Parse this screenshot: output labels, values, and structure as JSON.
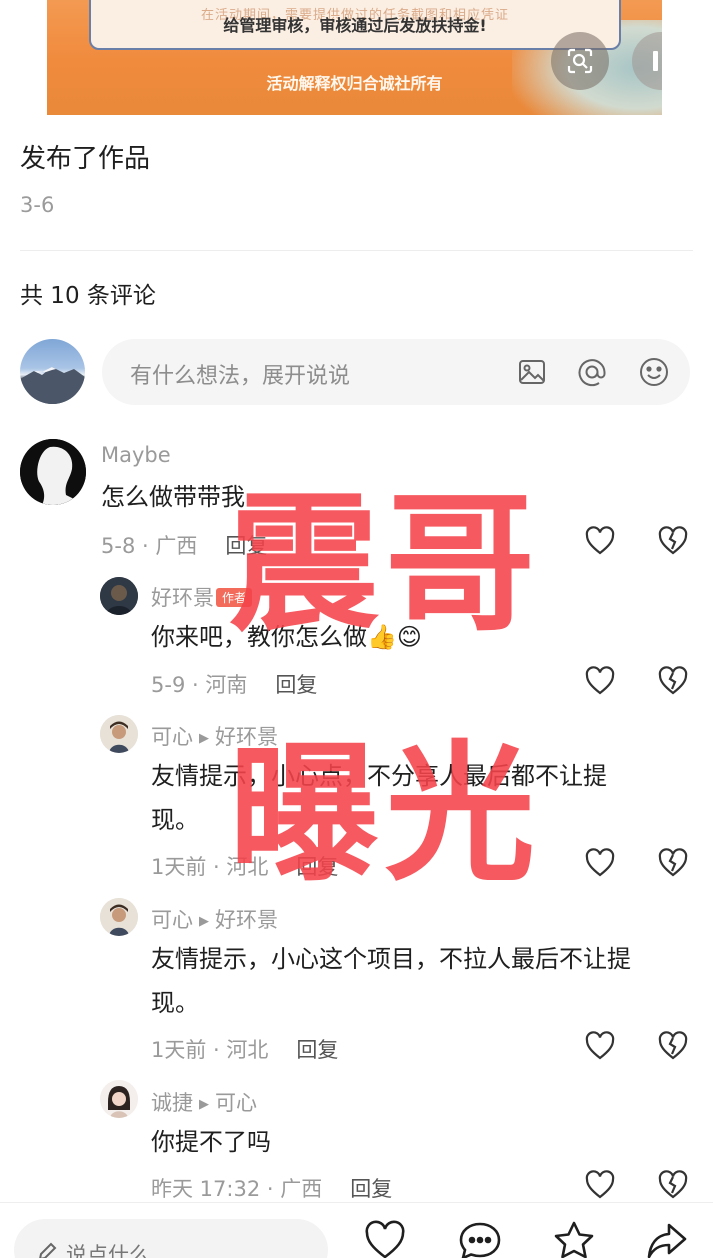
{
  "banner": {
    "notice_line1": "在活动期间，需要提供做过的任务截图和相应凭证",
    "notice_line2": "给管理审核，审核通过后发放扶持金!",
    "footer": "活动解释权归合诚社所有",
    "icons": {
      "lens": "lens-search-icon",
      "pause": "pause-icon"
    }
  },
  "post": {
    "title": "发布了作品",
    "date": "3-6"
  },
  "comments_header": "共 10 条评论",
  "comment_input": {
    "placeholder": "有什么想法，展开说说",
    "icons": [
      "image-icon",
      "at-icon",
      "emoji-icon"
    ]
  },
  "comments": [
    {
      "user": "Maybe",
      "text": "怎么做带带我",
      "meta": "5-8 · 广西",
      "reply": "回复"
    },
    {
      "user": "好环景",
      "badge": "作者",
      "text": "你来吧，教你怎么做👍😊",
      "meta": "5-9 · 河南",
      "reply": "回复"
    },
    {
      "user": "可心",
      "reply_to": "好环景",
      "text_line1": "友情提示，小心点，不分享人最后都不让提",
      "text_line2": "现。",
      "meta": "1天前 · 河北",
      "reply": "回复"
    },
    {
      "user": "可心",
      "reply_to": "好环景",
      "text_line1": "友情提示，小心这个项目，不拉人最后不让提",
      "text_line2": "现。",
      "meta": "1天前 · 河北",
      "reply": "回复"
    },
    {
      "user": "诚捷",
      "reply_to": "可心",
      "text": "你提不了吗",
      "meta": "昨天 17:32 · 广西",
      "reply": "回复"
    }
  ],
  "watermark": {
    "line1": "震哥",
    "line2": "曝光",
    "color": "#f5434a"
  },
  "bottom_bar": {
    "placeholder": "说点什么",
    "icons": [
      "heart-icon",
      "comment-icon",
      "star-icon",
      "share-icon"
    ]
  }
}
